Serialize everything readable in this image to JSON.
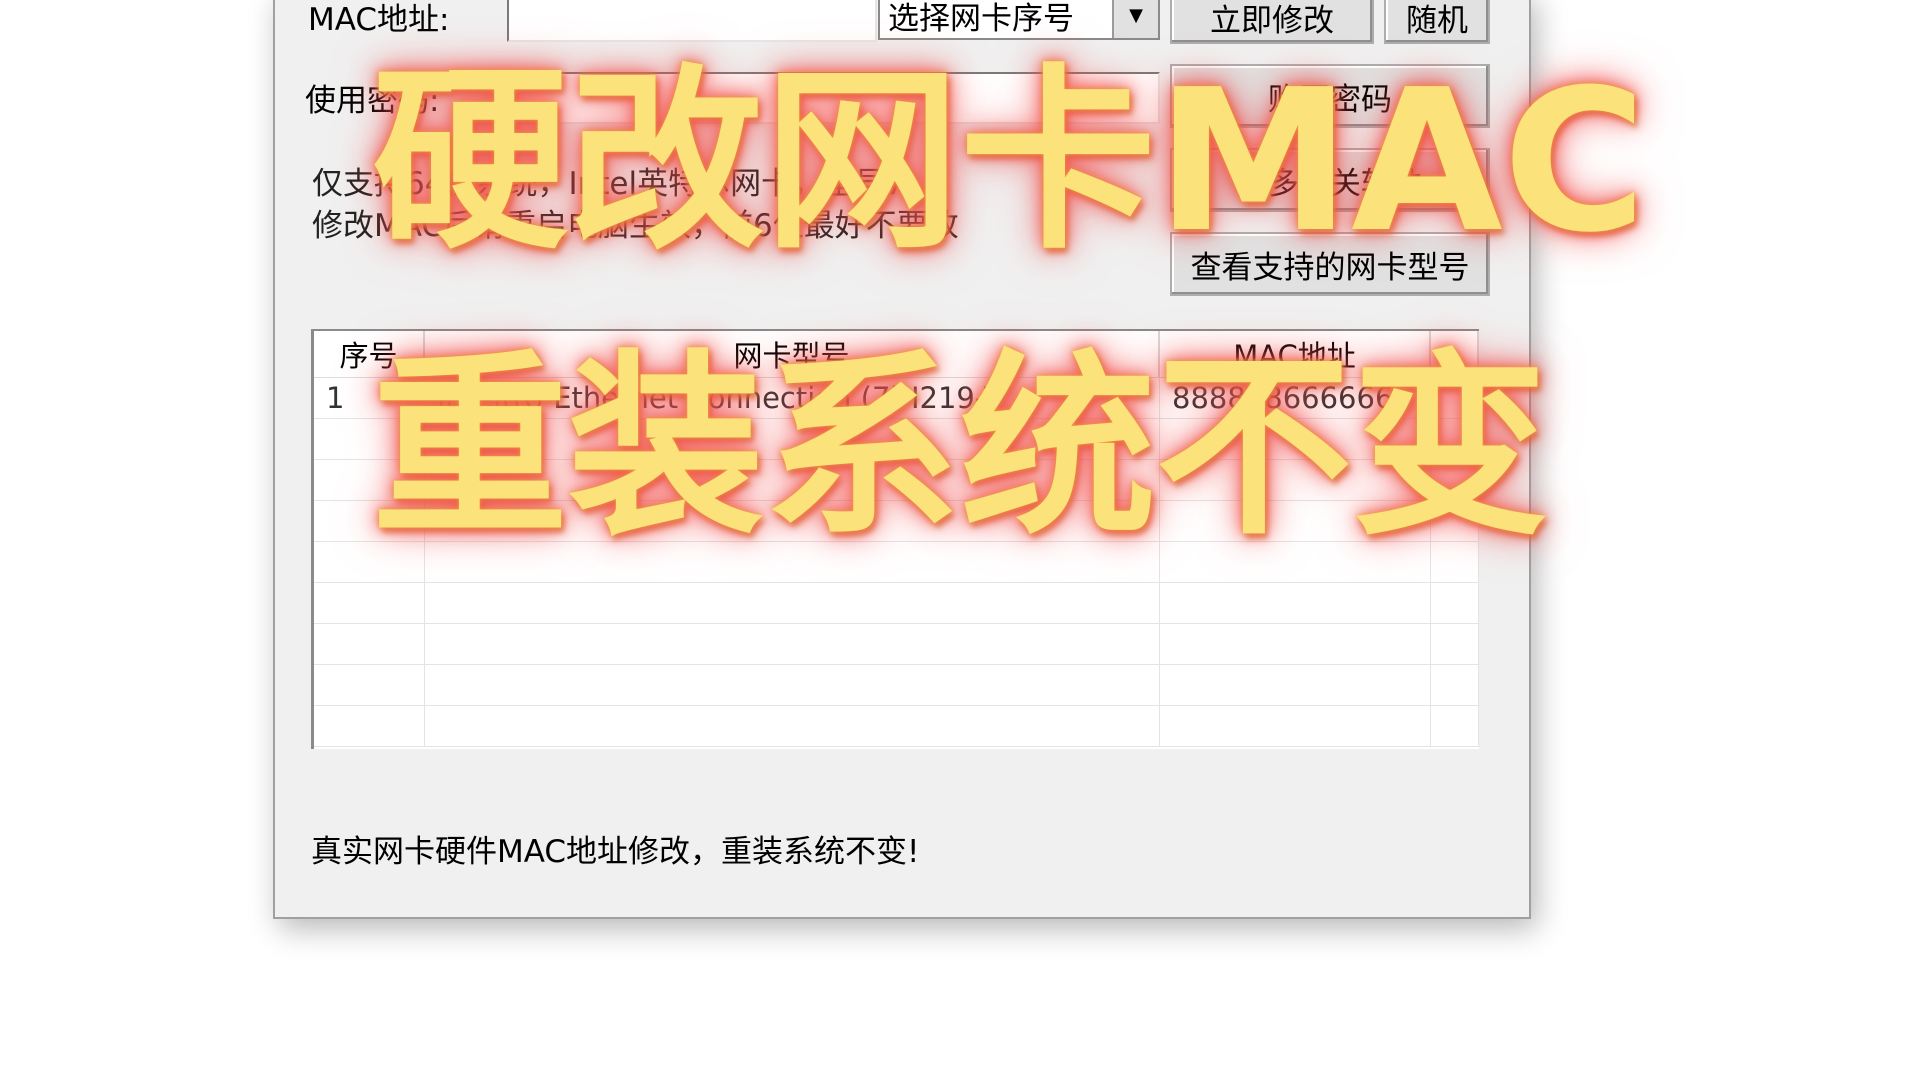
{
  "form": {
    "mac_label": "MAC地址:",
    "mac_value": "",
    "nic_select": "选择网卡序号",
    "apply_button": "立即修改",
    "random_button": "随机",
    "password_label": "使用密码:",
    "buy_password_button": "购买密码",
    "more_button": "更多相关软件",
    "supported_models_button": "查看支持的网卡型号",
    "hint_line1": "仅支持64位系统，Intel英特尔网卡，型号7",
    "hint_line2": "修改MAC后请重启电脑生效，前6位最好不要改"
  },
  "table": {
    "columns": [
      "序号",
      "网卡型号",
      "MAC地址",
      ""
    ],
    "rows": [
      [
        "1",
        "Intel(R) Ethernet Connection (7) I219-V",
        "888888666666",
        ""
      ]
    ]
  },
  "status_text": "真实网卡硬件MAC地址修改，重装系统不变!",
  "overlay": {
    "line1": "硬改网卡MAC",
    "line2": "重装系统不变"
  }
}
